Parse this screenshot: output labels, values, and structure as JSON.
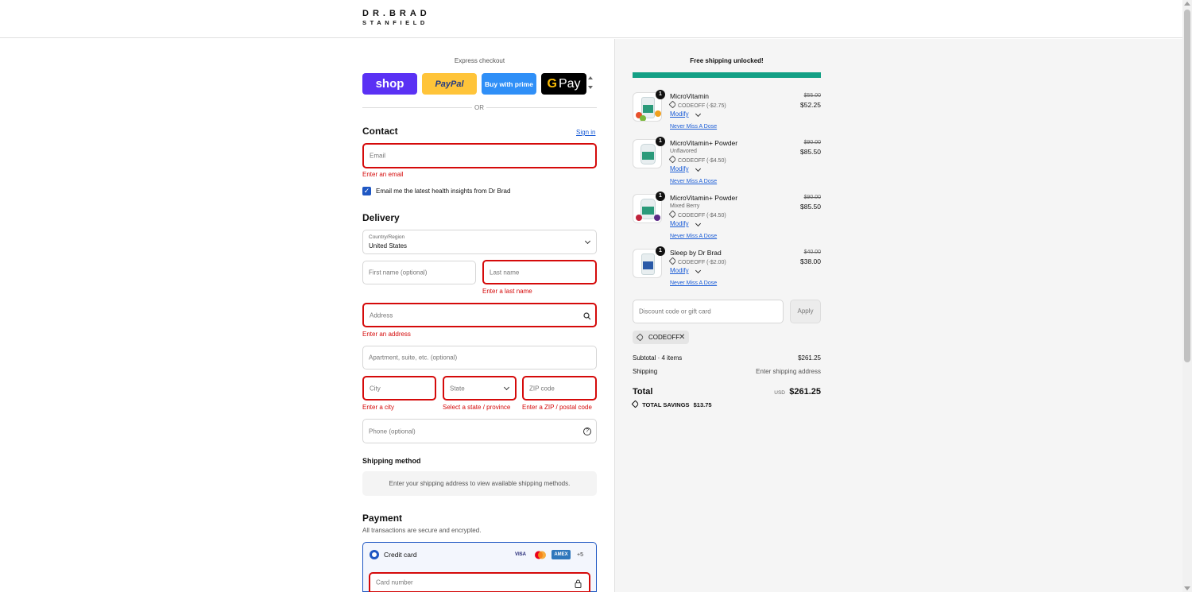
{
  "header": {
    "logo_line1": "DR.BRAD",
    "logo_line2": "STANFIELD"
  },
  "express": {
    "label": "Express checkout",
    "shop": "shop",
    "paypal": "PayPal",
    "amazon": "Buy with prime",
    "gpay": "Pay",
    "or": "OR"
  },
  "contact": {
    "title": "Contact",
    "sign_in": "Sign in",
    "email_placeholder": "Email",
    "email_error": "Enter an email",
    "newsletter_label": "Email me the latest health insights from Dr Brad",
    "newsletter_checked": true
  },
  "delivery": {
    "title": "Delivery",
    "country_label": "Country/Region",
    "country_value": "United States",
    "first_name_placeholder": "First name (optional)",
    "last_name_placeholder": "Last name",
    "last_name_error": "Enter a last name",
    "address_placeholder": "Address",
    "address_error": "Enter an address",
    "apartment_placeholder": "Apartment, suite, etc. (optional)",
    "city_placeholder": "City",
    "city_error": "Enter a city",
    "state_placeholder": "State",
    "state_error": "Select a state / province",
    "zip_placeholder": "ZIP code",
    "zip_error": "Enter a ZIP / postal code",
    "phone_placeholder": "Phone (optional)"
  },
  "shipping_method": {
    "title": "Shipping method",
    "message": "Enter your shipping address to view available shipping methods."
  },
  "payment": {
    "title": "Payment",
    "subtitle": "All transactions are secure and encrypted.",
    "credit_card_label": "Credit card",
    "card_visa": "VISA",
    "card_amex": "AMEX",
    "card_more": "+5",
    "card_number_placeholder": "Card number"
  },
  "summary": {
    "free_shipping": "Free shipping unlocked!",
    "free_shipping_progress": 1.0,
    "items": [
      {
        "name": "MicroVitamin",
        "variant": "",
        "code": "CODEOFF (-$2.75)",
        "modify": "Modify",
        "never_miss": "Never Miss A Dose",
        "qty": "1",
        "price_old": "$55.00",
        "price_new": "$52.25"
      },
      {
        "name": "MicroVitamin+ Powder",
        "variant": "Unflavored",
        "code": "CODEOFF (-$4.50)",
        "modify": "Modify",
        "never_miss": "Never Miss A Dose",
        "qty": "1",
        "price_old": "$90.00",
        "price_new": "$85.50"
      },
      {
        "name": "MicroVitamin+ Powder",
        "variant": "Mixed Berry",
        "code": "CODEOFF (-$4.50)",
        "modify": "Modify",
        "never_miss": "Never Miss A Dose",
        "qty": "1",
        "price_old": "$90.00",
        "price_new": "$85.50"
      },
      {
        "name": "Sleep by Dr Brad",
        "variant": "",
        "code": "CODEOFF (-$2.00)",
        "modify": "Modify",
        "never_miss": "Never Miss A Dose",
        "qty": "1",
        "price_old": "$40.00",
        "price_new": "$38.00"
      }
    ],
    "discount_placeholder": "Discount code or gift card",
    "apply": "Apply",
    "applied_code": "CODEOFF",
    "subtotal_label": "Subtotal · 4 items",
    "subtotal_value": "$261.25",
    "shipping_label": "Shipping",
    "shipping_value": "Enter shipping address",
    "total_label": "Total",
    "total_currency": "USD",
    "total_value": "$261.25",
    "savings_label": "TOTAL SAVINGS",
    "savings_value": "$13.75"
  },
  "colors": {
    "accent": "#1f57c3",
    "error": "#d50a0a",
    "progress": "#13a085",
    "shop": "#5a31f4",
    "paypal": "#ffc439",
    "amazon": "#2f8ff7"
  }
}
